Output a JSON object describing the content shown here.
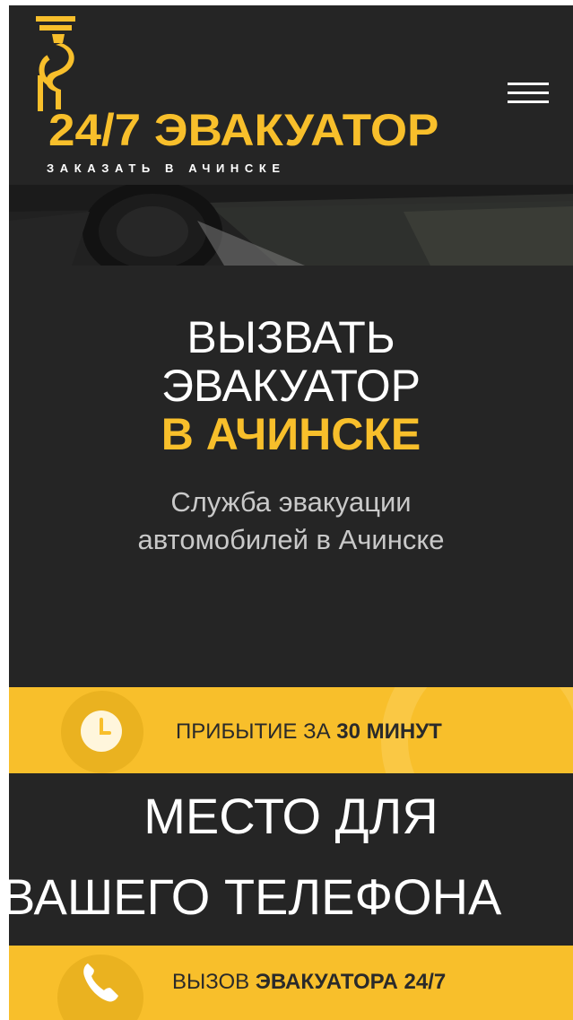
{
  "header": {
    "brand": "24/7 ЭВАКУАТОР",
    "subtitle": "ЗАКАЗАТЬ В АЧИНСКЕ",
    "menu_icon": "hamburger-menu-icon",
    "logo_icon": "tow-hook-icon"
  },
  "hero": {
    "title_line_1": "ВЫЗВАТЬ",
    "title_line_2": "ЭВАКУАТОР",
    "title_line_3": "В АЧИНСКЕ",
    "subtitle_line_1": "Служба эвакуации",
    "subtitle_line_2": "автомобилей в Ачинске"
  },
  "arrival_bar": {
    "icon": "clock-icon",
    "text_regular": "ПРИБЫТИЕ ЗА ",
    "text_bold": "30 МИНУТ"
  },
  "phone_placeholder": {
    "line_1": "МЕСТО ДЛЯ",
    "line_2": "ВАШЕГО ТЕЛЕФОНА"
  },
  "call_bar": {
    "icon": "phone-icon",
    "text_regular": "ВЫЗОВ ",
    "text_bold": "ЭВАКУАТОРА 24/7"
  },
  "colors": {
    "accent": "#f8bf2b",
    "background": "#252525",
    "text_light": "#ffffff",
    "text_muted": "#c9c9c9",
    "text_dark": "#2a2a2a"
  }
}
